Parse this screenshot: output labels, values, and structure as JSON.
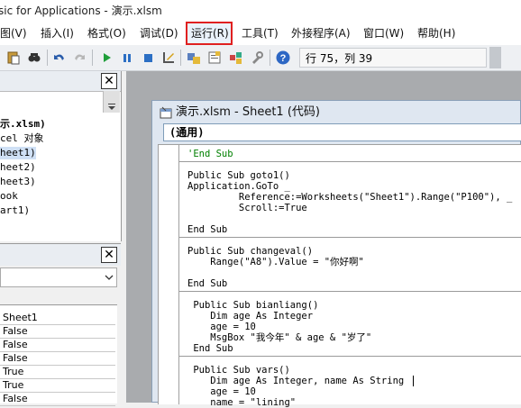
{
  "window": {
    "title": "sic for Applications - 演示.xlsm"
  },
  "menu": {
    "items": [
      {
        "label": "图(V)"
      },
      {
        "label": "插入(I)"
      },
      {
        "label": "格式(O)"
      },
      {
        "label": "调试(D)"
      },
      {
        "label": "运行(R)"
      },
      {
        "label": "工具(T)"
      },
      {
        "label": "外接程序(A)"
      },
      {
        "label": "窗口(W)"
      },
      {
        "label": "帮助(H)"
      }
    ],
    "highlighted": "运行(R)",
    "highlight_color": "#e02020"
  },
  "toolbar": {
    "icons": [
      "paste-icon",
      "find-icon",
      "undo-icon",
      "redo-icon",
      "run-icon",
      "break-icon",
      "reset-icon",
      "design-mode-icon",
      "project-explorer-icon",
      "properties-icon",
      "object-browser-icon",
      "toolbox-icon",
      "help-icon"
    ],
    "position": "行 75，列 39"
  },
  "project": {
    "items": [
      "示.xlsm)",
      "cel 对象",
      "heet1)",
      "heet2)",
      "heet3)",
      "ook",
      "art1)"
    ]
  },
  "properties": {
    "values": [
      "Sheet1",
      "False",
      "False",
      "False",
      "True",
      "True",
      "False"
    ]
  },
  "code_window": {
    "title": "演示.xlsm - Sheet1 (代码)",
    "object_combo": "(通用)",
    "lines": [
      "'End Sub",
      "",
      "Public Sub goto1()",
      "Application.GoTo _",
      "         Reference:=Worksheets(\"Sheet1\").Range(\"P100\"), _",
      "         Scroll:=True",
      "",
      "End Sub",
      "",
      "Public Sub changeval()",
      "    Range(\"A8\").Value = \"你好啊\"",
      "",
      "End Sub",
      "",
      " Public Sub bianliang()",
      "    Dim age As Integer",
      "    age = 10",
      "    MsgBox \"我今年\" & age & \"岁了\"",
      " End Sub",
      "",
      " Public Sub vars()",
      "    Dim age As Integer, name As String",
      "    age = 10",
      "    name = \"lining\""
    ]
  }
}
